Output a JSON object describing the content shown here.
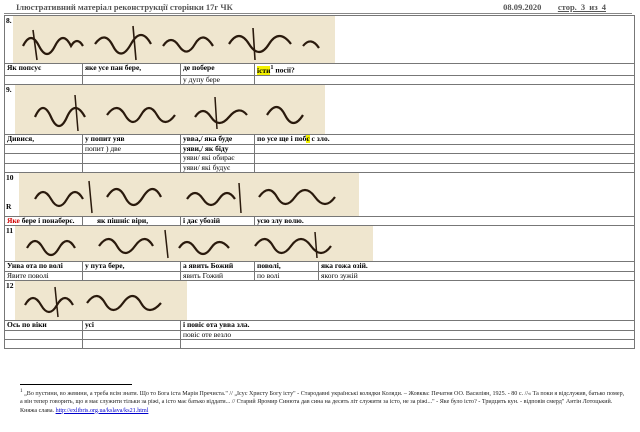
{
  "header": {
    "title": "Ілюстративний матеріал  реконструкції сторінки 17г  ЧК",
    "date": "08.09.2020",
    "page": "стор. 3 из 4"
  },
  "rows": [
    {
      "num": "8.",
      "scan_text": "всего багаслеас баловаре",
      "lines": [
        {
          "cells": [
            "Як попсує",
            "яке усе пан бере,",
            "де побере",
            "істи",
            "1",
            " посії?"
          ]
        },
        {
          "cells": [
            "",
            "",
            "у дупу бере",
            "",
            "",
            ""
          ]
        }
      ]
    },
    {
      "num": "9.",
      "scan_text": "сего стово обае истеаве",
      "lines": [
        {
          "cells": [
            "Дивися,",
            "у попит уяв",
            "увва,/ яка буде",
            "по усе ще і поб",
            "є",
            " с зло."
          ]
        },
        {
          "cells": [
            "",
            "попит ) две",
            "уяви,/ як біду",
            "",
            "",
            ""
          ]
        },
        {
          "cells": [
            "",
            "",
            "уяви/ які обирає",
            "",
            "",
            ""
          ]
        },
        {
          "cells": [
            "",
            "",
            "уяви/ які будує",
            "",
            "",
            ""
          ]
        }
      ]
    },
    {
      "num": "10",
      "marker": "R",
      "scan_text": "бас всеас вессов бае ба вое",
      "lines": [
        {
          "cells": [
            "Яке",
            " бере і понаберє.",
            "як пішніс віри,",
            "і дає убозій",
            "усю злу волю."
          ]
        }
      ]
    },
    {
      "num": "11",
      "scan_text": "Нстов дто олсню пос ваниб",
      "lines": [
        {
          "cells": [
            "Унва ота по волі",
            "у пута бере,",
            "а явить Божий",
            "поволі,",
            "яка гожа озій."
          ]
        },
        {
          "cells": [
            "Явите поволі",
            "",
            "явить Гожий",
            "по волі",
            "якого зужій"
          ]
        }
      ]
    },
    {
      "num": "12",
      "scan_text": "всеов а сстов",
      "lines": [
        {
          "cells": [
            "Ось по віки",
            "усі",
            "і повіс ота увва зла."
          ]
        },
        {
          "cells": [
            "",
            "",
            "повіс оте везло"
          ]
        }
      ]
    }
  ],
  "footnote": {
    "marker": "1",
    "text": " „Во пустини, во жевини, а треба всім знати. Що то Бога іста Марія Пречиста.\" // „Ісус Христу Богу істу\" - Стародавні українські колядки Коляди. – Жовква: Печатня ОО. Василіян, 1925. - 80 с.   //« Та поки я відслужив, батько помер, а він тепер говорить, що я має служити тільки за ріжі, а істо має батько віддати... // Старий Яромир Синюта дав сина на десять літ служити за істо, не за ріжі...\" - Яке було істо? - Тридцять кун. - відповів смерд\" Антін Лотоцький. Княжа слава.",
    "link": "http://exlibris.org.ua/kslava/ks21.html"
  }
}
